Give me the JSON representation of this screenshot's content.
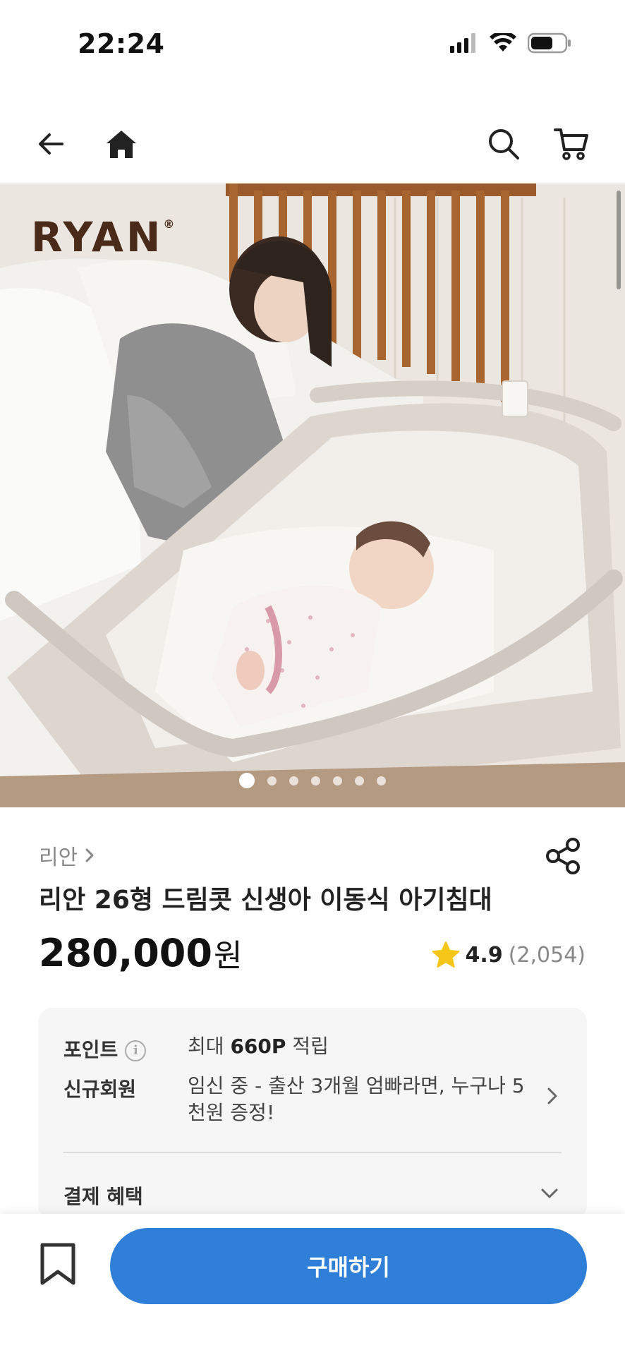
{
  "status_bar": {
    "time": "22:24"
  },
  "nav": {
    "back_icon": "arrow-left-icon",
    "home_icon": "home-icon",
    "search_icon": "search-icon",
    "cart_icon": "cart-icon"
  },
  "hero": {
    "brand_logo": "RYAN",
    "brand_logo_mark": "®",
    "carousel": {
      "total": 7,
      "active_index": 0
    }
  },
  "product": {
    "brand": "리안",
    "title": "리안 26형 드림콧 신생아 이동식 아기침대",
    "price": "280,000",
    "price_unit": "원",
    "rating": "4.9",
    "review_count": "(2,054)"
  },
  "benefits": {
    "points_label": "포인트",
    "points_value_prefix": "최대",
    "points_value_amount": "660P",
    "points_value_suffix": "적립",
    "new_member_label": "신규회원",
    "new_member_value": "임신 중 - 출산 3개월 엄빠라면, 누구나 5천원 증정!",
    "payment_label": "결제 혜택"
  },
  "bottom_bar": {
    "buy_label": "구매하기"
  },
  "colors": {
    "accent": "#2f7fd8",
    "star": "#f5c518",
    "brand_logo": "#4a2a18"
  }
}
